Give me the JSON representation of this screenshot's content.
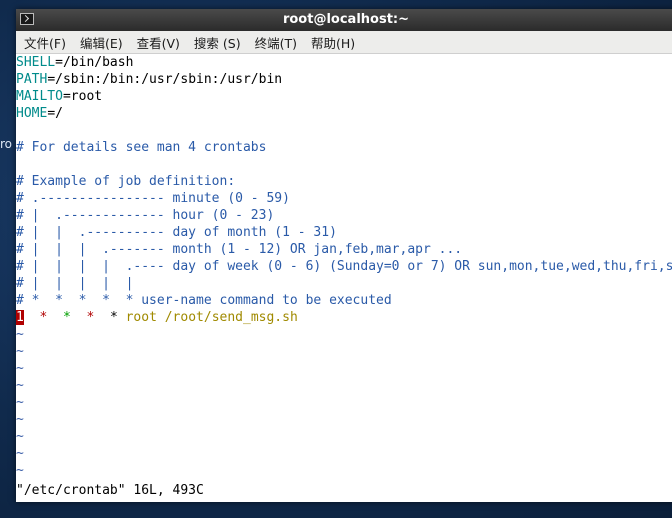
{
  "desktop": {
    "label": "ro"
  },
  "window": {
    "title": "root@localhost:~"
  },
  "menu": [
    "文件(F)",
    "编辑(E)",
    "查看(V)",
    "搜索 (S)",
    "终端(T)",
    "帮助(H)"
  ],
  "env": [
    {
      "name": "SHELL",
      "value": "/bin/bash"
    },
    {
      "name": "PATH",
      "value": "/sbin:/bin:/usr/sbin:/usr/bin"
    },
    {
      "name": "MAILTO",
      "value": "root"
    },
    {
      "name": "HOME",
      "value": "/"
    }
  ],
  "comments": {
    "details": "# For details see man 4 crontabs",
    "example": [
      "# Example of job definition:",
      "# .---------------- minute (0 - 59)",
      "# |  .------------- hour (0 - 23)",
      "# |  |  .---------- day of month (1 - 31)",
      "# |  |  |  .------- month (1 - 12) OR jan,feb,mar,apr ...",
      "# |  |  |  |  .---- day of week (0 - 6) (Sunday=0 or 7) OR sun,mon,tue,wed,thu,fri,sat",
      "# |  |  |  |  |",
      "# *  *  *  *  * user-name command to be executed"
    ]
  },
  "job": {
    "minute": "1",
    "hour": "*",
    "dom": "*",
    "month": "*",
    "dow": "*",
    "user": "root",
    "command": "/root/send_msg.sh"
  },
  "tilde": "~",
  "status": "\"/etc/crontab\" 16L, 493C"
}
